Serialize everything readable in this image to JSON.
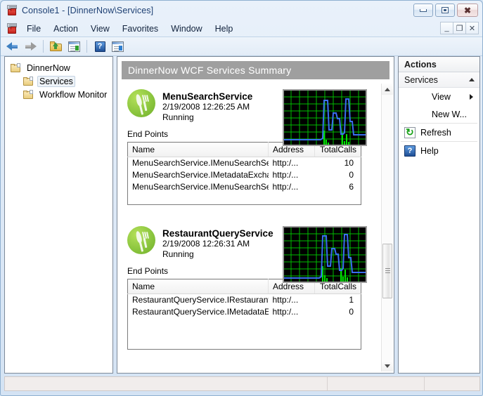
{
  "window": {
    "title": "Console1 - [DinnerNow\\Services]",
    "icon": "mmc-console-icon",
    "buttons": {
      "minimize": "minimize",
      "restore": "restore",
      "close": "close"
    },
    "mdi_buttons": {
      "minimize": "_",
      "restore": "❐",
      "close": "✕"
    }
  },
  "menubar": {
    "items": [
      "File",
      "Action",
      "View",
      "Favorites",
      "Window",
      "Help"
    ]
  },
  "toolbar": {
    "items": [
      {
        "name": "back-button",
        "icon": "back-arrow-icon"
      },
      {
        "name": "forward-button",
        "icon": "forward-arrow-icon"
      },
      {
        "name": "up-one-level-button",
        "icon": "folder-up-icon"
      },
      {
        "name": "show-hide-console-tree-button",
        "icon": "console-tree-icon"
      },
      {
        "name": "help-button",
        "icon": "help-icon"
      },
      {
        "name": "show-hide-action-pane-button",
        "icon": "action-pane-icon"
      }
    ]
  },
  "tree": {
    "nodes": [
      {
        "label": "DinnerNow",
        "level": 0,
        "selected": false
      },
      {
        "label": "Services",
        "level": 1,
        "selected": true
      },
      {
        "label": "Workflow Monitor",
        "level": 1,
        "selected": false
      }
    ]
  },
  "center": {
    "header": "DinnerNow WCF Services Summary",
    "endpoints_label": "End Points",
    "columns": [
      "Name",
      "Address",
      "TotalCalls"
    ],
    "services": [
      {
        "name": "MenuSearchService",
        "timestamp": "2/19/2008 12:26:25 AM",
        "status": "Running",
        "logo": "dinnernow-logo-icon",
        "endpoints": [
          {
            "name": "MenuSearchService.IMenuSearchServi...",
            "address": "http:/...",
            "total_calls": "10"
          },
          {
            "name": "MenuSearchService.IMetadataExchang...",
            "address": "http:/...",
            "total_calls": "0"
          },
          {
            "name": "MenuSearchService.IMenuSearchServi...",
            "address": "http:/...",
            "total_calls": "6"
          }
        ]
      },
      {
        "name": "RestaurantQueryService",
        "timestamp": "2/19/2008 12:26:31 AM",
        "status": "Running",
        "logo": "dinnernow-logo-icon",
        "endpoints": [
          {
            "name": "RestaurantQueryService.IRestaurantQu...",
            "address": "http:/...",
            "total_calls": "1"
          },
          {
            "name": "RestaurantQueryService.IMetadataExch...",
            "address": "http:/...",
            "total_calls": "0"
          }
        ]
      }
    ],
    "scrollbar": {
      "up": "scroll-up",
      "down": "scroll-down",
      "thumb": "scroll-thumb"
    }
  },
  "actions": {
    "title": "Actions",
    "group": {
      "label": "Services",
      "collapse_icon": "caret-up-icon"
    },
    "items": [
      {
        "label": "View",
        "icon": "none",
        "submenu": true
      },
      {
        "label": "New W...",
        "icon": "none",
        "submenu": false
      },
      {
        "label": "Refresh",
        "icon": "refresh-icon",
        "submenu": false
      },
      {
        "label": "Help",
        "icon": "help-icon",
        "submenu": false
      }
    ]
  },
  "statusbar": {
    "cells": [
      "",
      "",
      ""
    ]
  },
  "colors": {
    "accent": "#1d3f73",
    "summary_header_bg": "#9f9f9f",
    "chart_bg": "#000000",
    "chart_grid": "#00c000",
    "chart_line_blue": "#3a6ef0",
    "chart_line_green": "#00e000",
    "logo_green": "#8cc63f"
  },
  "chart_data": {
    "type": "line",
    "title": "",
    "xlabel": "",
    "ylabel": "",
    "grid": true,
    "legend": "none",
    "xlim": [
      0,
      100
    ],
    "ylim": [
      0,
      100
    ],
    "charts": [
      {
        "service": "MenuSearchService",
        "series": [
          {
            "name": "blue-line",
            "color": "#3a6ef0",
            "x": [
              0,
              52,
              55,
              57,
              60,
              62,
              64,
              66,
              68,
              70,
              72,
              74,
              76,
              78,
              80,
              82,
              84,
              86,
              88,
              90,
              100
            ],
            "y": [
              8,
              8,
              10,
              74,
              78,
              30,
              26,
              55,
              58,
              50,
              30,
              24,
              24,
              78,
              80,
              48,
              44,
              16,
              14,
              14,
              14
            ]
          },
          {
            "name": "green-bars",
            "color": "#00e000",
            "x": [
              53,
              55,
              57,
              59,
              72,
              74,
              76,
              78,
              80,
              82
            ],
            "y": [
              0,
              22,
              4,
              0,
              0,
              18,
              2,
              16,
              4,
              0
            ]
          }
        ]
      },
      {
        "service": "RestaurantQueryService",
        "series": [
          {
            "name": "blue-line",
            "color": "#3a6ef0",
            "x": [
              0,
              50,
              53,
              55,
              58,
              60,
              62,
              64,
              66,
              68,
              70,
              72,
              74,
              76,
              78,
              80,
              82,
              84,
              86,
              88,
              100
            ],
            "y": [
              6,
              6,
              10,
              76,
              80,
              32,
              28,
              56,
              60,
              52,
              30,
              24,
              24,
              80,
              82,
              50,
              44,
              14,
              12,
              12,
              12
            ]
          },
          {
            "name": "green-bars",
            "color": "#00e000",
            "x": [
              51,
              53,
              55,
              57,
              70,
              72,
              74,
              76,
              78,
              80
            ],
            "y": [
              0,
              24,
              6,
              0,
              0,
              20,
              4,
              18,
              4,
              0
            ]
          }
        ]
      }
    ]
  }
}
